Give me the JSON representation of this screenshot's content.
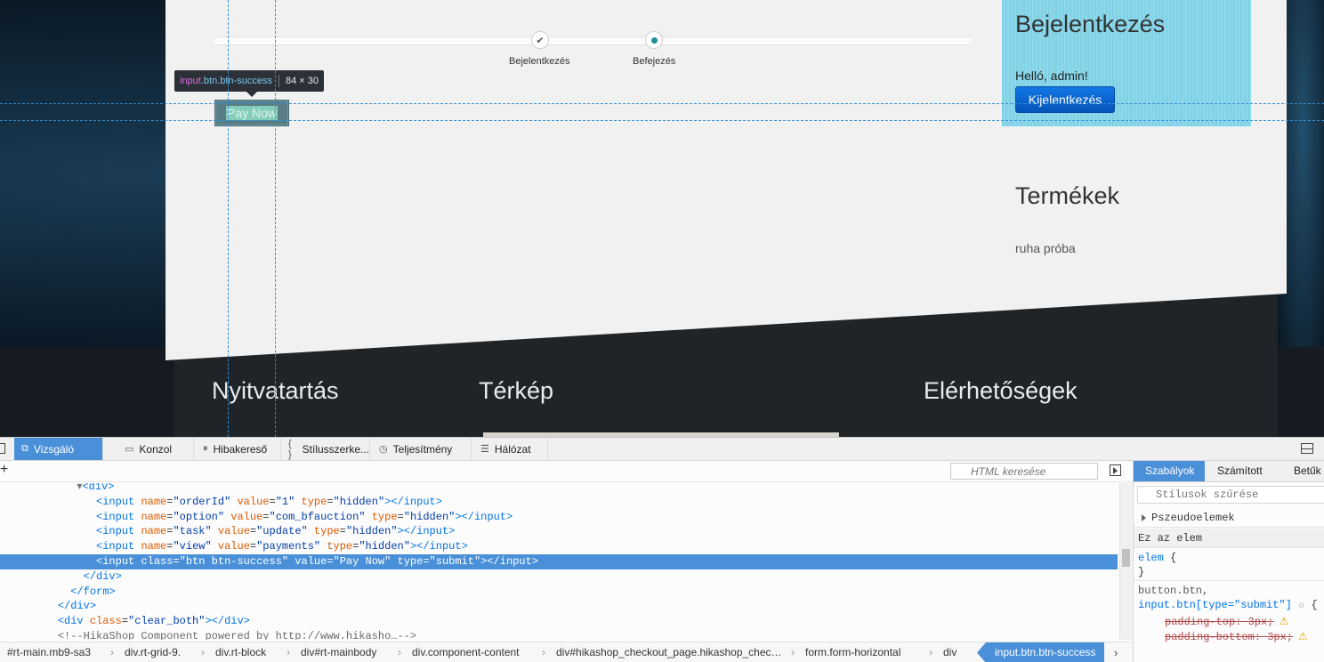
{
  "site": {
    "steps": [
      {
        "label": "Bejelentkezés",
        "icon": "checkmark-icon",
        "glyph": "✔"
      },
      {
        "label": "Befejezés",
        "icon": "current-step-dot-icon"
      }
    ],
    "pay_button": "Pay Now",
    "inspector_tooltip": {
      "tag": "input",
      "classes": ".btn.btn-success",
      "dims": "84 × 30"
    },
    "login": {
      "title": "Bejelentkezés",
      "greeting": "Helló, admin!",
      "logout_label": "Kijelentkezés"
    },
    "products": {
      "title": "Termékek",
      "items": [
        "ruha próba"
      ]
    },
    "footer": {
      "headings": [
        "Nyitvatartás",
        "Térkép",
        "Elérhetőségek"
      ]
    },
    "colors": {
      "login_bg": "#7fd1e6",
      "logout_btn": "#0b66d6",
      "highlight": "#4a90d9",
      "guide": "#2f8ed8"
    }
  },
  "devtools": {
    "tabs": [
      {
        "label": "Vizsgáló",
        "icon": "inspector-icon",
        "glyph": "⧉"
      },
      {
        "label": "Konzol",
        "icon": "console-icon",
        "glyph": "▭"
      },
      {
        "label": "Hibakereső",
        "icon": "debugger-icon",
        "glyph": "⏸"
      },
      {
        "label": "Stílusszerke...",
        "icon": "style-editor-icon",
        "glyph": "{ }"
      },
      {
        "label": "Teljesítmény",
        "icon": "performance-icon",
        "glyph": "◷"
      },
      {
        "label": "Hálózat",
        "icon": "network-icon",
        "glyph": "☰"
      }
    ],
    "html_search_placeholder": "HTML keresése",
    "add_node_glyph": "+",
    "markup": {
      "lines": [
        {
          "indent": "            ",
          "arrow": "▾",
          "tag": "<div>"
        },
        {
          "indent": "               ",
          "tag_open": "<input",
          "attrs": [
            [
              "name",
              "orderId"
            ],
            [
              "value",
              "1"
            ],
            [
              "type",
              "hidden"
            ]
          ],
          "tag_close": "></input>"
        },
        {
          "indent": "               ",
          "tag_open": "<input",
          "attrs": [
            [
              "name",
              "option"
            ],
            [
              "value",
              "com_bfauction"
            ],
            [
              "type",
              "hidden"
            ]
          ],
          "tag_close": "></input>"
        },
        {
          "indent": "               ",
          "tag_open": "<input",
          "attrs": [
            [
              "name",
              "task"
            ],
            [
              "value",
              "update"
            ],
            [
              "type",
              "hidden"
            ]
          ],
          "tag_close": "></input>"
        },
        {
          "indent": "               ",
          "tag_open": "<input",
          "attrs": [
            [
              "name",
              "view"
            ],
            [
              "value",
              "payments"
            ],
            [
              "type",
              "hidden"
            ]
          ],
          "tag_close": "></input>"
        },
        {
          "indent": "               ",
          "tag_open": "<input",
          "attrs": [
            [
              "class",
              "btn btn-success"
            ],
            [
              "value",
              "Pay Now"
            ],
            [
              "type",
              "submit"
            ]
          ],
          "tag_close": "></input>",
          "selected": true
        },
        {
          "indent": "             ",
          "tag": "</div>"
        },
        {
          "indent": "           ",
          "tag": "</form>"
        },
        {
          "indent": "         ",
          "tag": "</div>"
        },
        {
          "indent": "         ",
          "tag_open": "<div",
          "attrs": [
            [
              "class",
              "clear_both"
            ]
          ],
          "tag_close": "></div>"
        },
        {
          "indent": "         ",
          "comment": "<!--HikaShop Component powered by http://www.hikasho…-->"
        }
      ]
    },
    "breadcrumbs": [
      "#rt-main.mb9-sa3",
      "div.rt-grid-9.",
      "div.rt-block",
      "div#rt-mainbody",
      "div.component-content",
      "div#hikashop_checkout_page.hikashop_chec…",
      "form.form-horizontal",
      "div",
      "input.btn.btn-success"
    ],
    "sidebar": {
      "tabs": [
        "Szabályok",
        "Számított",
        "Betűk"
      ],
      "filter_placeholder": "Stílusok szűrése",
      "pseudo_label": "Pszeudoelemek",
      "this_element_label": "Ez az elem",
      "elem_rule": {
        "selector": "elem",
        "open": "{",
        "close": "}"
      },
      "btn_rule": {
        "selector_line1": "button.btn,",
        "selector_line2": "input.btn[type=\"submit\"]",
        "open": "{",
        "props": [
          {
            "name": "padding-top",
            "value": "3px"
          },
          {
            "name": "padding-bottom",
            "value": "3px"
          }
        ]
      }
    }
  }
}
